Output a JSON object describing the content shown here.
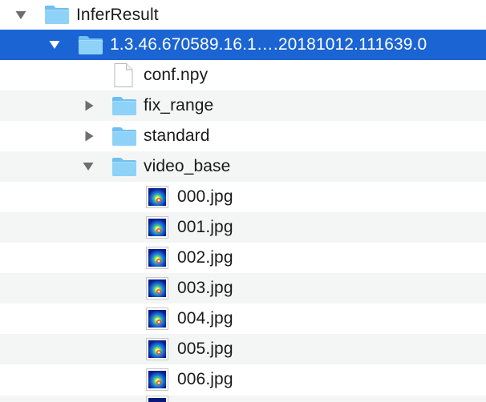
{
  "colors": {
    "selection": "#1b64d4",
    "folder_body": "#8fd1f7",
    "folder_tab": "#6fc0f0",
    "stripe": "#f4f5f5"
  },
  "tree": {
    "root": {
      "label": "InferResult",
      "expanded": true,
      "icon": "folder-icon"
    },
    "series": {
      "label": "1.3.46.670589.16.1….20181012.111639.0",
      "expanded": true,
      "selected": true,
      "icon": "folder-icon"
    },
    "items": [
      {
        "label": "conf.npy",
        "kind": "file",
        "icon": "document-icon"
      },
      {
        "label": "fix_range",
        "kind": "folder",
        "expanded": false,
        "icon": "folder-icon"
      },
      {
        "label": "standard",
        "kind": "folder",
        "expanded": false,
        "icon": "folder-icon"
      },
      {
        "label": "video_base",
        "kind": "folder",
        "expanded": true,
        "icon": "folder-icon"
      }
    ],
    "images": [
      {
        "label": "000.jpg",
        "icon": "image-thumbnail-icon"
      },
      {
        "label": "001.jpg",
        "icon": "image-thumbnail-icon"
      },
      {
        "label": "002.jpg",
        "icon": "image-thumbnail-icon"
      },
      {
        "label": "003.jpg",
        "icon": "image-thumbnail-icon"
      },
      {
        "label": "004.jpg",
        "icon": "image-thumbnail-icon"
      },
      {
        "label": "005.jpg",
        "icon": "image-thumbnail-icon"
      },
      {
        "label": "006.jpg",
        "icon": "image-thumbnail-icon"
      }
    ]
  }
}
